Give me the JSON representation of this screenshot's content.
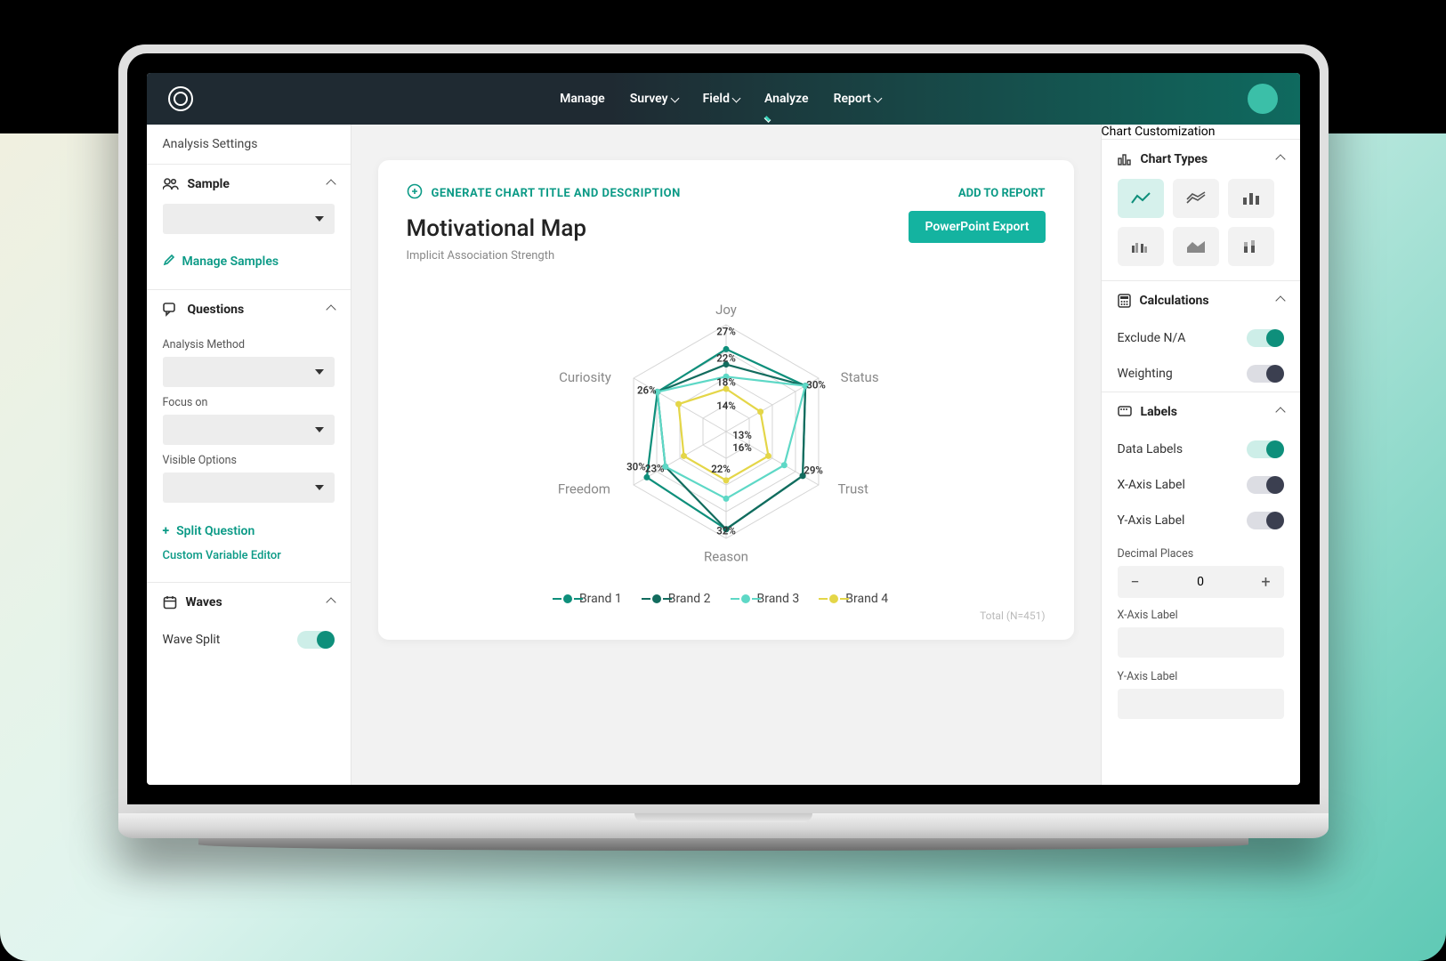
{
  "nav": {
    "items": [
      "Manage",
      "Survey",
      "Field",
      "Analyze",
      "Report"
    ],
    "dropdowns": [
      false,
      true,
      true,
      true,
      true
    ],
    "active_index": 3
  },
  "left": {
    "title": "Analysis Settings",
    "sample": {
      "label": "Sample",
      "manage_link": "Manage Samples"
    },
    "questions": {
      "label": "Questions",
      "analysis_method_label": "Analysis Method",
      "focus_on_label": "Focus on",
      "visible_options_label": "Visible Options",
      "split_question_link": "Split Question",
      "custom_var_link": "Custom Variable Editor"
    },
    "waves": {
      "label": "Waves",
      "wave_split_label": "Wave Split",
      "wave_split_on": true
    }
  },
  "card": {
    "generate_link": "GENERATE CHART TITLE AND DESCRIPTION",
    "add_to_report": "ADD TO REPORT",
    "export_btn": "PowerPoint Export",
    "title": "Motivational Map",
    "subtitle": "Implicit Association Strength",
    "total_n": "Total (N=451)",
    "legend": [
      "Brand 1",
      "Brand 2",
      "Brand 3",
      "Brand 4"
    ],
    "colors": [
      "#0e8f7b",
      "#126c5e",
      "#5ed8c6",
      "#e4d648"
    ]
  },
  "chart_data": {
    "type": "radar",
    "categories": [
      "Joy",
      "Status",
      "Trust",
      "Reason",
      "Freedom",
      "Curiosity"
    ],
    "series": [
      {
        "name": "Brand 1",
        "color": "#0e8f7b",
        "values": [
          27,
          30,
          29,
          32,
          30,
          26
        ]
      },
      {
        "name": "Brand 2",
        "color": "#126c5e",
        "values": [
          22,
          30,
          29,
          32,
          23,
          26
        ]
      },
      {
        "name": "Brand 3",
        "color": "#5ed8c6",
        "values": [
          18,
          30,
          22,
          22,
          23,
          26
        ]
      },
      {
        "name": "Brand 4",
        "color": "#e4d648",
        "values": [
          14,
          13,
          16,
          16,
          16,
          18
        ]
      }
    ],
    "label_points": {
      "Joy": [
        27,
        22,
        18,
        14
      ],
      "Status": [
        30
      ],
      "Trust": [
        29
      ],
      "Reason": [
        32
      ],
      "Freedom": [
        30,
        23
      ],
      "Curiosity": [
        26
      ],
      "center": [
        13,
        16,
        22
      ]
    },
    "max": 35
  },
  "right": {
    "title": "Chart Customization",
    "chart_types_label": "Chart Types",
    "calculations_label": "Calculations",
    "exclude_na_label": "Exclude N/A",
    "exclude_na_on": true,
    "weighting_label": "Weighting",
    "weighting_on": false,
    "labels_label": "Labels",
    "data_labels_label": "Data Labels",
    "data_labels_on": true,
    "x_axis_toggle_label": "X-Axis Label",
    "x_axis_toggle_on": false,
    "y_axis_toggle_label": "Y-Axis Label",
    "y_axis_toggle_on": false,
    "decimal_places_label": "Decimal Places",
    "decimal_places_value": "0",
    "x_axis_input_label": "X-Axis Label",
    "y_axis_input_label": "Y-Axis Label"
  }
}
